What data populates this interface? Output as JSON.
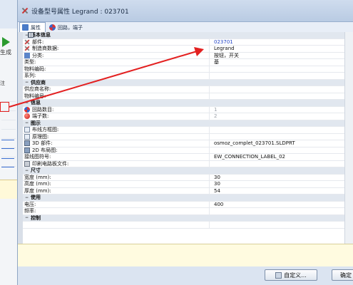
{
  "background_app": {
    "generate_label": "生成",
    "attr_label": "注"
  },
  "dialog": {
    "title": "设备型号属性 Legrand : 023701",
    "tabs": [
      {
        "label": "属性",
        "icon": "properties-icon"
      },
      {
        "label": "回路，端子",
        "icon": "circuit-icon"
      }
    ]
  },
  "properties": {
    "basic": {
      "header": "基本信息",
      "part_label": "部件:",
      "part_value": "023701",
      "manufacturer_label": "制造商数据:",
      "manufacturer_value": "Legrand",
      "class_label": "分类:",
      "class_value": "按钮，开关",
      "type_label": "类型:",
      "type_value": "基",
      "material_label": "物料编码:",
      "material_value": "",
      "series_label": "系列:",
      "series_value": ""
    },
    "supplier": {
      "header": "供应商",
      "supplier_name_label": "供应商名称:",
      "item_number_label": "物料编号:"
    },
    "info": {
      "header": "信息",
      "circuits_label": "回路数目:",
      "circuits_value": "1",
      "terminals_label": "端子数:",
      "terminals_value": "2"
    },
    "graphics": {
      "header": "图示",
      "wiring_label": "布线方框图:",
      "schematic_label": "原理图:",
      "part3d_label": "3D 部件:",
      "part3d_value": "osmoz_complet_023701.SLDPRT",
      "layout2d_label": "2D 布局图:",
      "wiring_symbol_label": "接线图符号:",
      "wiring_symbol_value": "EW_CONNECTION_LABEL_02",
      "print_label_label": "印刷电路板文件:"
    },
    "dimensions": {
      "header": "尺寸",
      "width_label": "宽度 (mm):",
      "width_value": "30",
      "height_label": "高度 (mm):",
      "height_value": "30",
      "depth_label": "厚度 (mm):",
      "depth_value": "54"
    },
    "usage": {
      "header": "使用",
      "voltage_label": "电压:",
      "voltage_value": "400",
      "frequency_label": "频率:",
      "frequency_value": ""
    },
    "control": {
      "header": "控制"
    }
  },
  "footer": {
    "custom_button": "自定义...",
    "ok_button": "确定"
  },
  "colors": {
    "link_value": "#2345c7",
    "annotation": "#e32020"
  }
}
